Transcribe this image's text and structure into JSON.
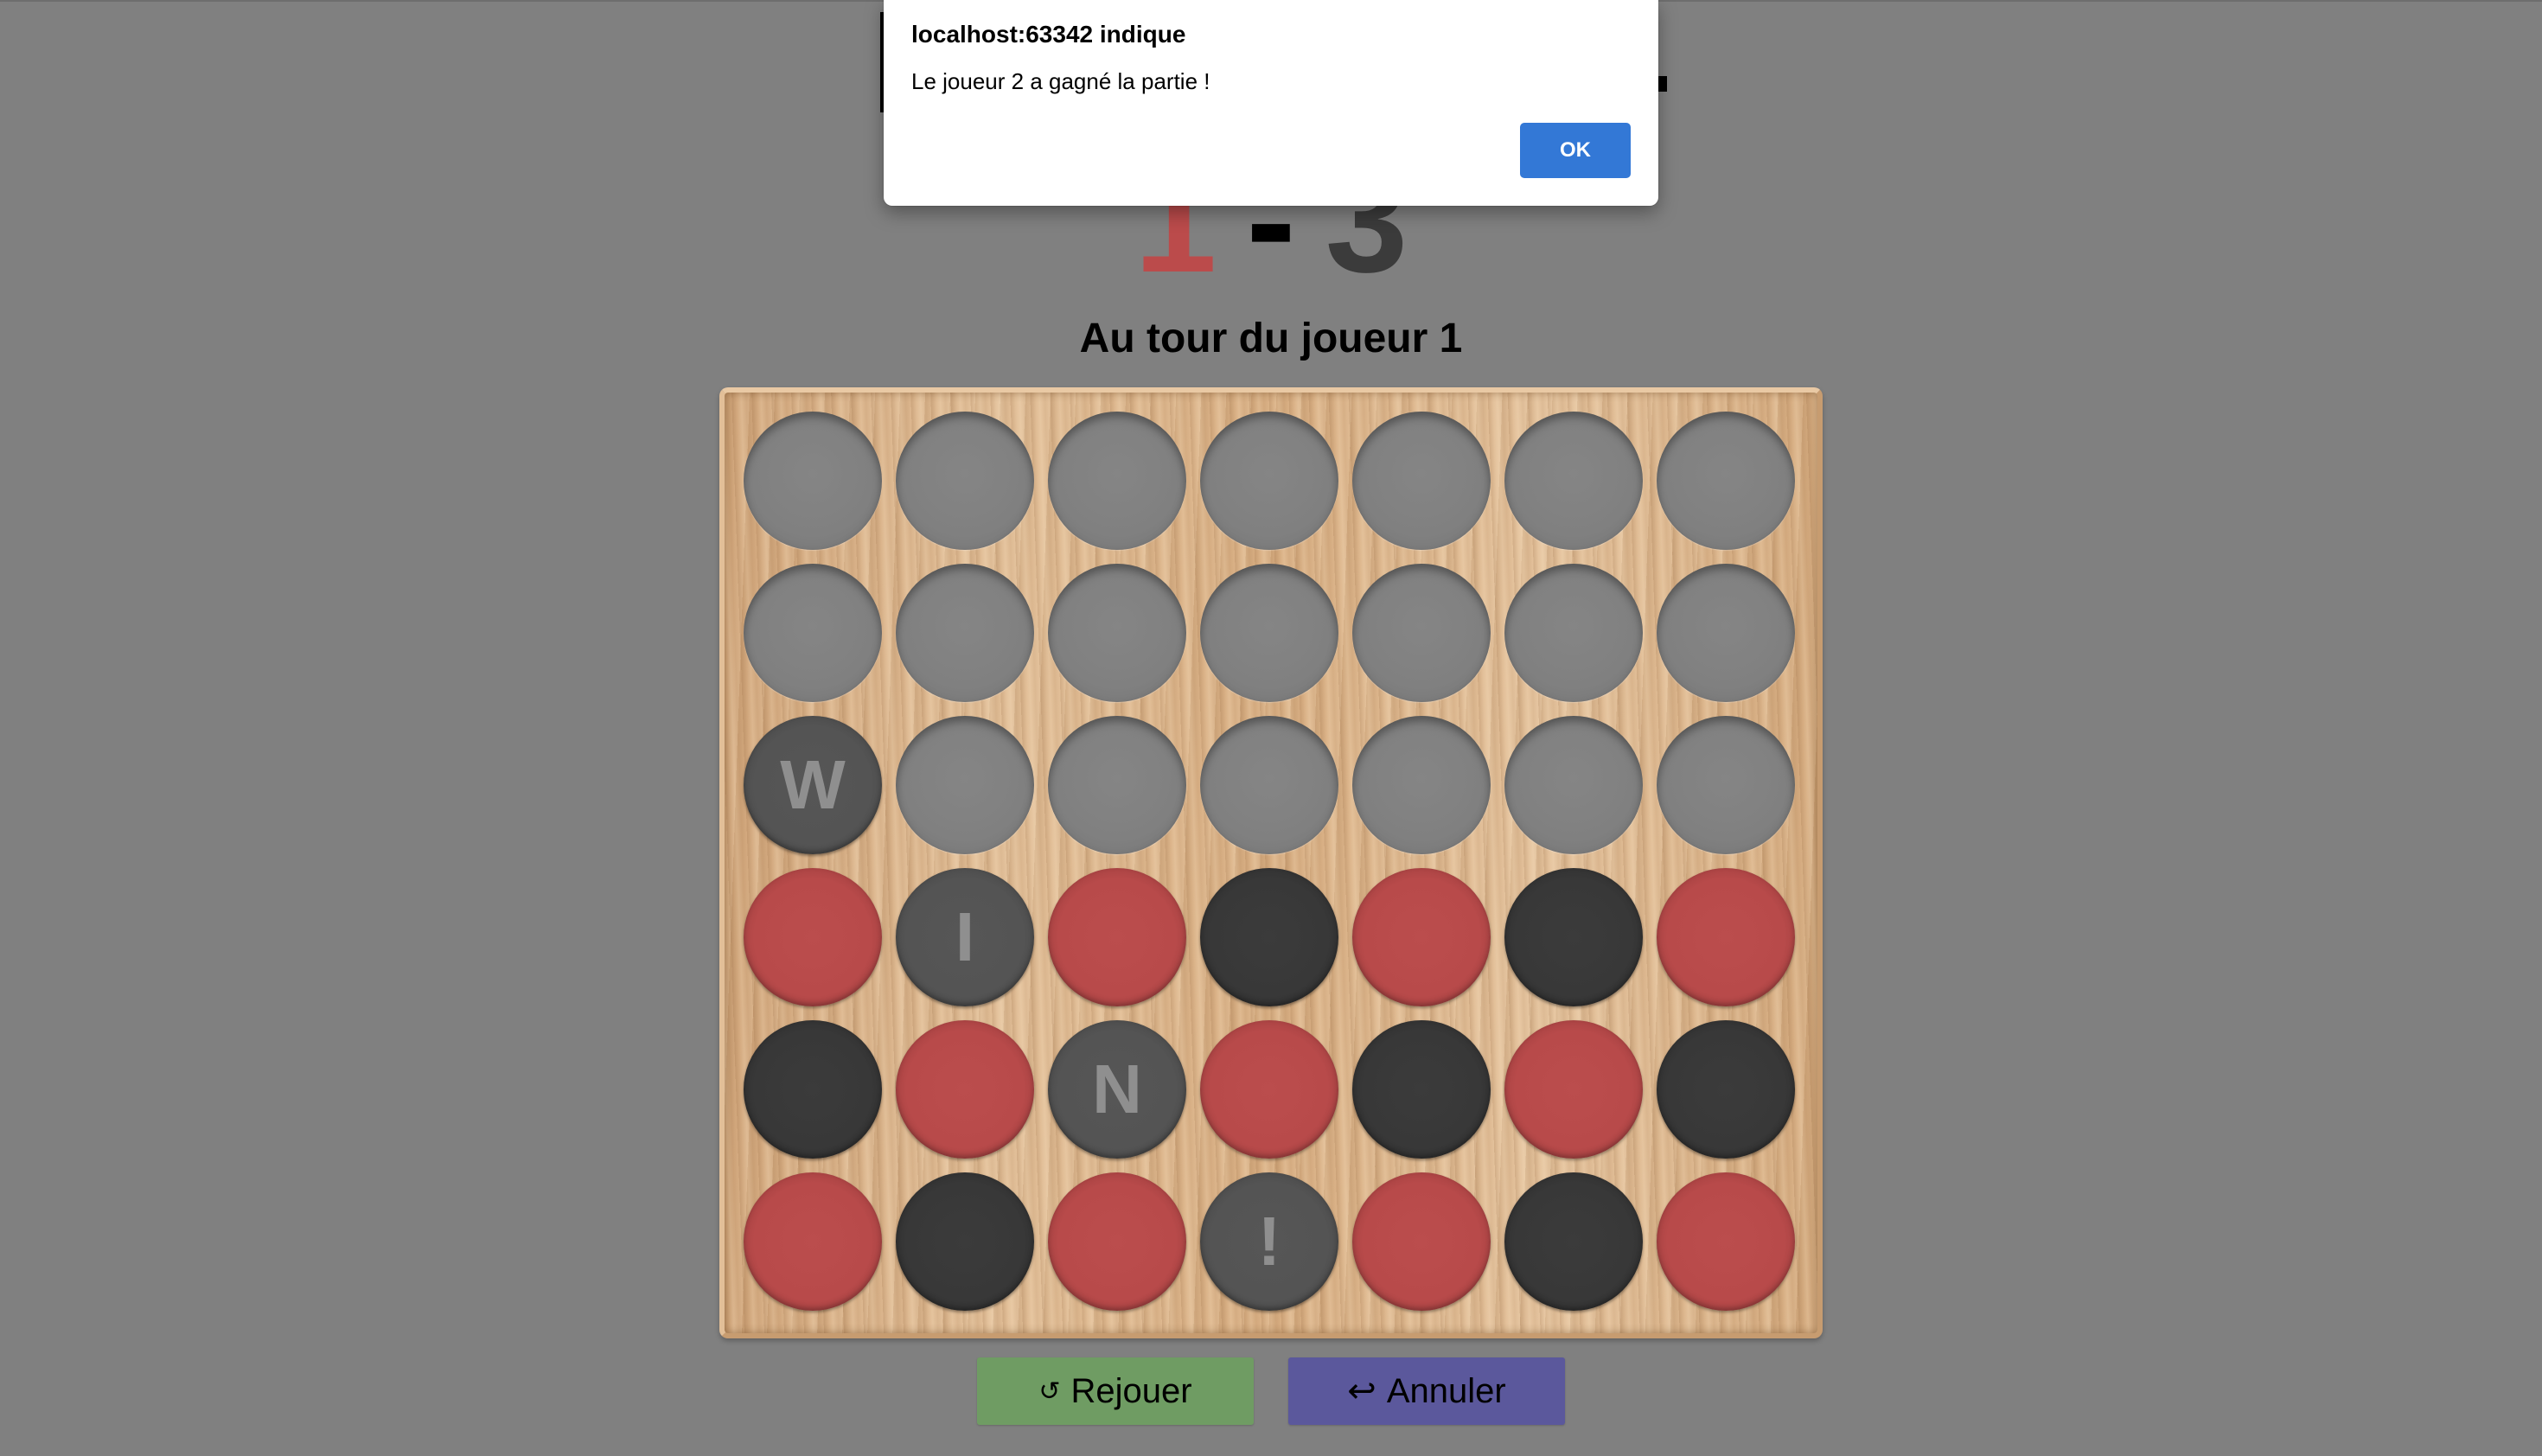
{
  "alert": {
    "title": "localhost:63342 indique",
    "message": "Le joueur 2 a gagné la partie !",
    "ok_label": "OK"
  },
  "score": {
    "player1": "1",
    "separator": "-",
    "player2": "3"
  },
  "turn_label": "Au tour du joueur 1",
  "board": {
    "columns": 7,
    "rows": 6,
    "cells": [
      [
        {
          "s": "empty"
        },
        {
          "s": "empty"
        },
        {
          "s": "empty"
        },
        {
          "s": "empty"
        },
        {
          "s": "empty"
        },
        {
          "s": "empty"
        },
        {
          "s": "empty"
        }
      ],
      [
        {
          "s": "empty"
        },
        {
          "s": "empty"
        },
        {
          "s": "empty"
        },
        {
          "s": "empty"
        },
        {
          "s": "empty"
        },
        {
          "s": "empty"
        },
        {
          "s": "empty"
        }
      ],
      [
        {
          "s": "win",
          "t": "W"
        },
        {
          "s": "empty"
        },
        {
          "s": "empty"
        },
        {
          "s": "empty"
        },
        {
          "s": "empty"
        },
        {
          "s": "empty"
        },
        {
          "s": "empty"
        }
      ],
      [
        {
          "s": "red"
        },
        {
          "s": "win",
          "t": "I"
        },
        {
          "s": "red"
        },
        {
          "s": "black"
        },
        {
          "s": "red"
        },
        {
          "s": "black"
        },
        {
          "s": "red"
        }
      ],
      [
        {
          "s": "black"
        },
        {
          "s": "red"
        },
        {
          "s": "win",
          "t": "N"
        },
        {
          "s": "red"
        },
        {
          "s": "black"
        },
        {
          "s": "red"
        },
        {
          "s": "black"
        }
      ],
      [
        {
          "s": "red"
        },
        {
          "s": "black"
        },
        {
          "s": "red"
        },
        {
          "s": "win",
          "t": "!"
        },
        {
          "s": "red"
        },
        {
          "s": "black"
        },
        {
          "s": "red"
        }
      ]
    ]
  },
  "buttons": {
    "replay_icon": "↺",
    "replay_label": "Rejouer",
    "undo_icon": "↩",
    "undo_label": "Annuler"
  },
  "colors": {
    "background": "#808080",
    "player1_red": "#b84a4a",
    "player2_black": "#383838",
    "replay_button": "#6f9c63",
    "undo_button": "#5b589c",
    "ok_button": "#3378d6"
  }
}
